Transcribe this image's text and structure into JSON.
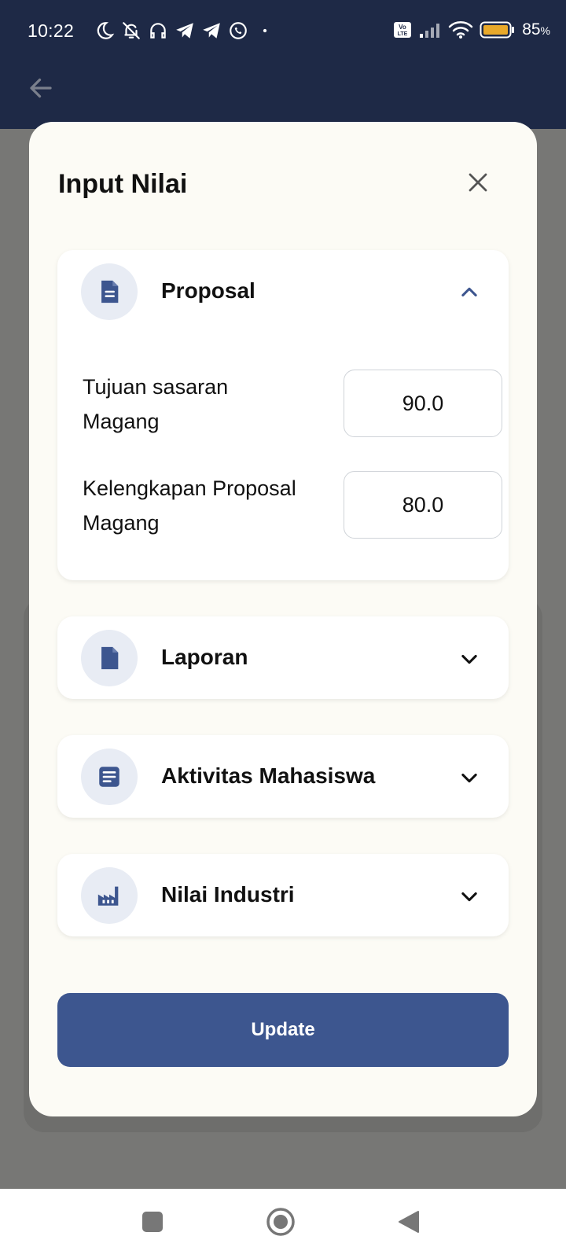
{
  "status_bar": {
    "time": "10:22",
    "battery_percent": "85",
    "battery_unit": "%",
    "icons_left": [
      "moon-icon",
      "bell-off-icon",
      "headphones-icon",
      "telegram-icon",
      "telegram-icon",
      "whatsapp-icon",
      "dot-icon"
    ],
    "icons_right": [
      "volte-icon",
      "signal-icon",
      "wifi-icon",
      "battery-icon"
    ]
  },
  "app_bar": {
    "back_icon": "arrow-left-icon"
  },
  "dialog": {
    "title": "Input Nilai",
    "close_icon": "close-icon",
    "sections": [
      {
        "label": "Proposal",
        "icon": "document-lines-icon",
        "expanded": true,
        "fields": [
          {
            "label": "Tujuan sasaran Magang",
            "value": "90.0"
          },
          {
            "label": "Kelengkapan Proposal Magang",
            "value": "80.0"
          }
        ]
      },
      {
        "label": "Laporan",
        "icon": "document-icon",
        "expanded": false
      },
      {
        "label": "Aktivitas Mahasiswa",
        "icon": "article-icon",
        "expanded": false
      },
      {
        "label": "Nilai Industri",
        "icon": "factory-icon",
        "expanded": false
      }
    ],
    "update_label": "Update"
  },
  "colors": {
    "header_bg": "#1e2946",
    "accent": "#3d568f",
    "dialog_bg": "#fcfbf5",
    "icon_circle_bg": "#e8ecf4"
  },
  "nav_bar": {
    "icons": [
      "square-icon",
      "home-circle-icon",
      "back-triangle-icon"
    ]
  }
}
